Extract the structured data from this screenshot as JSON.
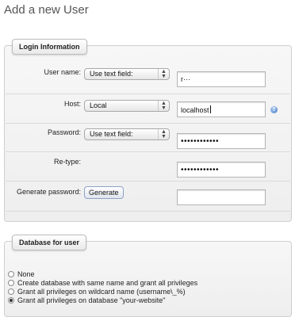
{
  "page": {
    "title": "Add a new User"
  },
  "login": {
    "legend": "Login Information",
    "user_name": {
      "label": "User name:",
      "select_value": "Use text field:",
      "input_value": "r···"
    },
    "host": {
      "label": "Host:",
      "select_value": "Local",
      "input_value": "localhost",
      "help_icon": "info-icon"
    },
    "password": {
      "label": "Password:",
      "select_value": "Use text field:",
      "input_value": "••••••••••••"
    },
    "retype": {
      "label": "Re-type:",
      "input_value": "••••••••••••"
    },
    "generate": {
      "label": "Generate password:",
      "button_label": "Generate",
      "input_value": ""
    }
  },
  "database": {
    "legend": "Database for user",
    "options": [
      {
        "label": "None",
        "checked": false
      },
      {
        "label": "Create database with same name and grant all privileges",
        "checked": false
      },
      {
        "label": "Grant all privileges on wildcard name (username\\_%)",
        "checked": false
      },
      {
        "label": "Grant all privileges on database \"your-website\"",
        "checked": true
      }
    ]
  },
  "colors": {
    "accent": "#4a7fc8",
    "panel_bg": "#f2f2f2",
    "border": "#cfcfcf"
  }
}
